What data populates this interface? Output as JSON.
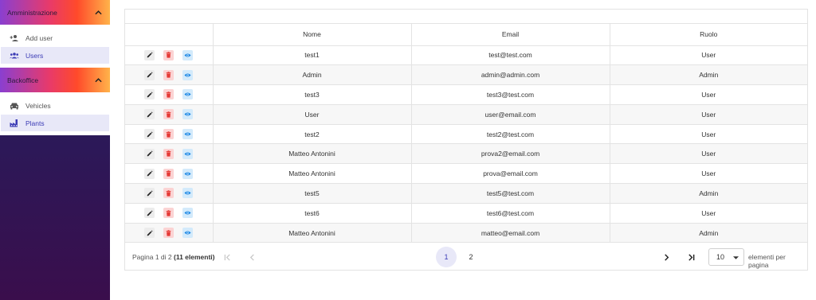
{
  "sidebar": {
    "groups": [
      {
        "title": "Amministrazione",
        "items": [
          {
            "label": "Add user",
            "icon": "person-add-icon",
            "active": false
          },
          {
            "label": "Users",
            "icon": "group-icon",
            "active": true
          }
        ]
      },
      {
        "title": "Backoffice",
        "items": [
          {
            "label": "Vehicles",
            "icon": "car-icon",
            "active": false
          },
          {
            "label": "Plants",
            "icon": "factory-icon",
            "active": true
          }
        ]
      }
    ]
  },
  "table": {
    "headers": [
      "",
      "Nome",
      "Email",
      "Ruolo"
    ],
    "rows": [
      {
        "nome": "test1",
        "email": "test@test.com",
        "ruolo": "User"
      },
      {
        "nome": "Admin",
        "email": "admin@admin.com",
        "ruolo": "Admin"
      },
      {
        "nome": "test3",
        "email": "test3@test.com",
        "ruolo": "User"
      },
      {
        "nome": "User",
        "email": "user@email.com",
        "ruolo": "User"
      },
      {
        "nome": "test2",
        "email": "test2@test.com",
        "ruolo": "User"
      },
      {
        "nome": "Matteo Antonini",
        "email": "prova2@email.com",
        "ruolo": "User"
      },
      {
        "nome": "Matteo Antonini",
        "email": "prova@email.com",
        "ruolo": "User"
      },
      {
        "nome": "test5",
        "email": "test5@test.com",
        "ruolo": "Admin"
      },
      {
        "nome": "test6",
        "email": "test6@test.com",
        "ruolo": "User"
      },
      {
        "nome": "Matteo Antonini",
        "email": "matteo@email.com",
        "ruolo": "Admin"
      }
    ]
  },
  "pagination": {
    "info_prefix": "Pagina 1 di 2",
    "info_count": "(11 elementi)",
    "pages": [
      "1",
      "2"
    ],
    "current_page": "1",
    "page_size": "10",
    "per_page_label": "elementi per pagina"
  },
  "colors": {
    "accent": "#3b3bb5",
    "delete": "#e53935",
    "view": "#1e88e5"
  }
}
